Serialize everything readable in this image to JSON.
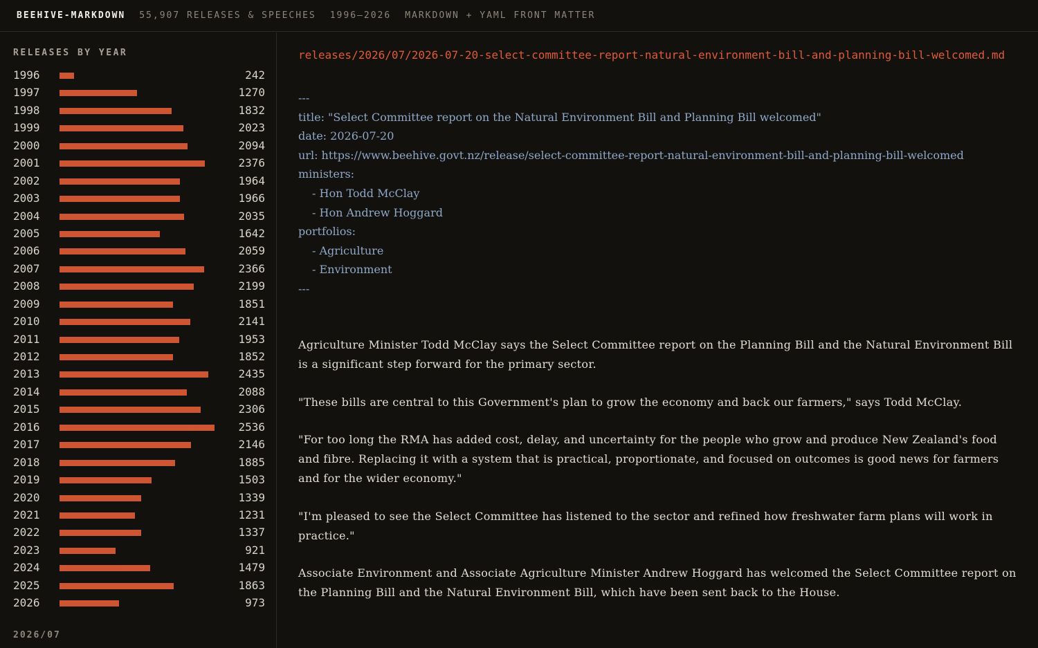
{
  "header": {
    "brand": "BEEHIVE-MARKDOWN",
    "count": "55,907 RELEASES & SPEECHES",
    "range": "1996–2026",
    "format": "MARKDOWN + YAML FRONT MATTER"
  },
  "sidebar": {
    "title": "RELEASES BY YEAR",
    "footer": "2026/07",
    "years": [
      {
        "year": "1996",
        "count": "242",
        "value": 242
      },
      {
        "year": "1997",
        "count": "1270",
        "value": 1270
      },
      {
        "year": "1998",
        "count": "1832",
        "value": 1832
      },
      {
        "year": "1999",
        "count": "2023",
        "value": 2023
      },
      {
        "year": "2000",
        "count": "2094",
        "value": 2094
      },
      {
        "year": "2001",
        "count": "2376",
        "value": 2376
      },
      {
        "year": "2002",
        "count": "1964",
        "value": 1964
      },
      {
        "year": "2003",
        "count": "1966",
        "value": 1966
      },
      {
        "year": "2004",
        "count": "2035",
        "value": 2035
      },
      {
        "year": "2005",
        "count": "1642",
        "value": 1642
      },
      {
        "year": "2006",
        "count": "2059",
        "value": 2059
      },
      {
        "year": "2007",
        "count": "2366",
        "value": 2366
      },
      {
        "year": "2008",
        "count": "2199",
        "value": 2199
      },
      {
        "year": "2009",
        "count": "1851",
        "value": 1851
      },
      {
        "year": "2010",
        "count": "2141",
        "value": 2141
      },
      {
        "year": "2011",
        "count": "1953",
        "value": 1953
      },
      {
        "year": "2012",
        "count": "1852",
        "value": 1852
      },
      {
        "year": "2013",
        "count": "2435",
        "value": 2435
      },
      {
        "year": "2014",
        "count": "2088",
        "value": 2088
      },
      {
        "year": "2015",
        "count": "2306",
        "value": 2306
      },
      {
        "year": "2016",
        "count": "2536",
        "value": 2536
      },
      {
        "year": "2017",
        "count": "2146",
        "value": 2146
      },
      {
        "year": "2018",
        "count": "1885",
        "value": 1885
      },
      {
        "year": "2019",
        "count": "1503",
        "value": 1503
      },
      {
        "year": "2020",
        "count": "1339",
        "value": 1339
      },
      {
        "year": "2021",
        "count": "1231",
        "value": 1231
      },
      {
        "year": "2022",
        "count": "1337",
        "value": 1337
      },
      {
        "year": "2023",
        "count": "921",
        "value": 921
      },
      {
        "year": "2024",
        "count": "1479",
        "value": 1479
      },
      {
        "year": "2025",
        "count": "1863",
        "value": 1863
      },
      {
        "year": "2026",
        "count": "973",
        "value": 973
      }
    ]
  },
  "document": {
    "path": "releases/2026/07/2026-07-20-select-committee-report-natural-environment-bill-and-planning-bill-welcomed.md",
    "frontmatter": {
      "open": "---",
      "title": "title: \"Select Committee report on the Natural Environment Bill and Planning Bill welcomed\"",
      "date": "date: 2026-07-20",
      "url": "url: https://www.beehive.govt.nz/release/select-committee-report-natural-environment-bill-and-planning-bill-welcomed",
      "ministers_key": "ministers:",
      "ministers": [
        "- Hon Todd McClay",
        "- Hon Andrew Hoggard"
      ],
      "portfolios_key": "portfolios:",
      "portfolios": [
        "- Agriculture",
        "- Environment"
      ],
      "close": "---"
    },
    "paragraphs": [
      "Agriculture Minister Todd McClay says the Select Committee report on the Planning Bill and the Natural Environment Bill is a significant step forward for the primary sector.",
      "\"These bills are central to this Government's plan to grow the economy and back our farmers,\" says Todd McClay.",
      "\"For too long the RMA has added cost, delay, and uncertainty for the people who grow and produce New Zealand's food and fibre. Replacing it with a system that is practical, proportionate, and focused on outcomes is good news for farmers and for the wider economy.\"",
      "\"I'm pleased to see the Select Committee has listened to the sector and refined how freshwater farm plans will work in practice.\"",
      "Associate Environment and Associate Agriculture Minister Andrew Hoggard has welcomed the Select Committee report on the Planning Bill and the Natural Environment Bill, which have been sent back to the House."
    ]
  },
  "colors": {
    "background": "#13110e",
    "bar": "#cd5531",
    "path": "#de5b35",
    "yaml": "#8fa8c8",
    "text": "#e2ddd2"
  }
}
